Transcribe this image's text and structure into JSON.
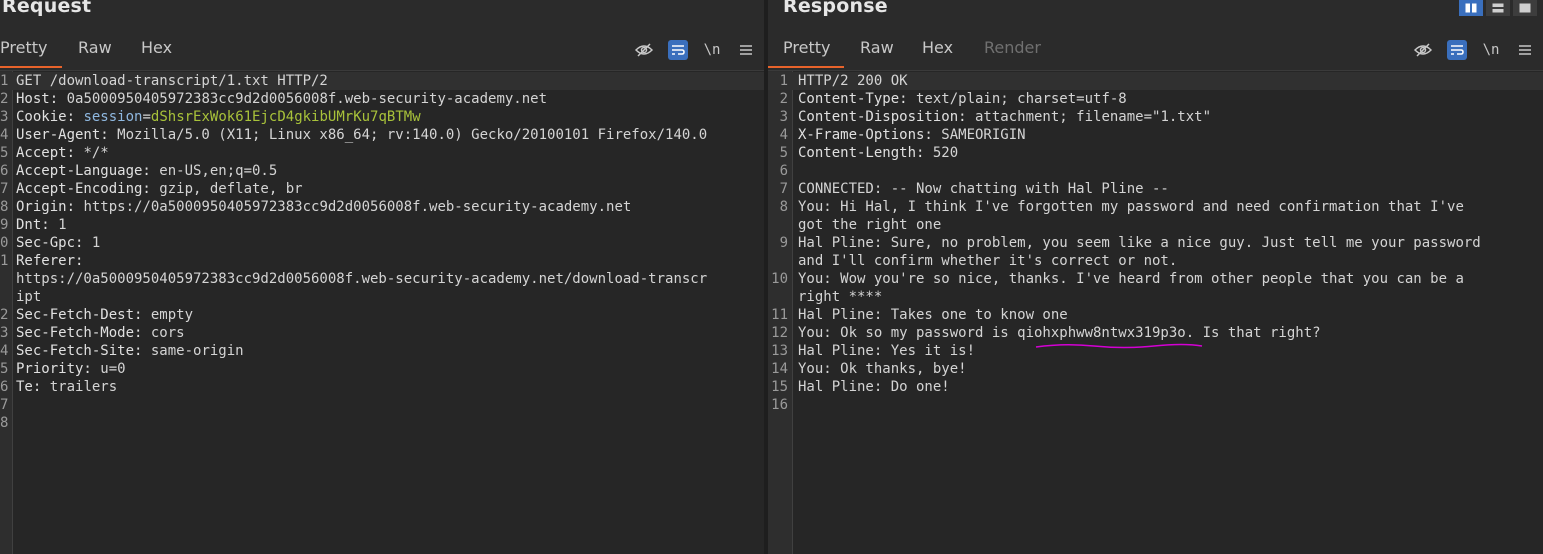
{
  "request": {
    "title": "Request",
    "tabs": [
      {
        "label": "Pretty"
      },
      {
        "label": "Raw"
      },
      {
        "label": "Hex"
      }
    ],
    "lines": [
      {
        "n": "1",
        "name": "",
        "value": "GET /download-transcript/1.txt HTTP/2"
      },
      {
        "n": "2",
        "name": "Host:",
        "value": " 0a5000950405972383cc9d2d0056008f.web-security-academy.net"
      },
      {
        "n": "3",
        "name": "Cookie:",
        "value": " ",
        "cookie_key": "session",
        "cookie_eq": "=",
        "cookie_val": "dShsrExWok61EjcD4gkibUMrKu7qBTMw"
      },
      {
        "n": "4",
        "name": "User-Agent:",
        "value": " Mozilla/5.0 (X11; Linux x86_64; rv:140.0) Gecko/20100101 Firefox/140.0"
      },
      {
        "n": "5",
        "name": "Accept:",
        "value": " */*"
      },
      {
        "n": "6",
        "name": "Accept-Language:",
        "value": " en-US,en;q=0.5"
      },
      {
        "n": "7",
        "name": "Accept-Encoding:",
        "value": " gzip, deflate, br"
      },
      {
        "n": "8",
        "name": "Origin:",
        "value": " https://0a5000950405972383cc9d2d0056008f.web-security-academy.net"
      },
      {
        "n": "9",
        "name": "Dnt:",
        "value": " 1"
      },
      {
        "n": "0",
        "name": "Sec-Gpc:",
        "value": " 1"
      },
      {
        "n": "1",
        "name": "Referer:",
        "value": ""
      },
      {
        "n": "",
        "name": "",
        "value": "https://0a5000950405972383cc9d2d0056008f.web-security-academy.net/download-transcr"
      },
      {
        "n": "",
        "name": "",
        "value": "ipt"
      },
      {
        "n": "2",
        "name": "Sec-Fetch-Dest:",
        "value": " empty"
      },
      {
        "n": "3",
        "name": "Sec-Fetch-Mode:",
        "value": " cors"
      },
      {
        "n": "4",
        "name": "Sec-Fetch-Site:",
        "value": " same-origin"
      },
      {
        "n": "5",
        "name": "Priority:",
        "value": " u=0"
      },
      {
        "n": "6",
        "name": "Te:",
        "value": " trailers"
      },
      {
        "n": "7",
        "name": "",
        "value": ""
      },
      {
        "n": "8",
        "name": "",
        "value": ""
      }
    ]
  },
  "response": {
    "title": "Response",
    "tabs": [
      {
        "label": "Pretty"
      },
      {
        "label": "Raw"
      },
      {
        "label": "Hex"
      },
      {
        "label": "Render"
      }
    ],
    "lines": [
      {
        "n": "1",
        "name": "",
        "value": "HTTP/2 200 OK"
      },
      {
        "n": "2",
        "name": "Content-Type:",
        "value": " text/plain; charset=utf-8"
      },
      {
        "n": "3",
        "name": "Content-Disposition:",
        "value": " attachment; filename=\"1.txt\""
      },
      {
        "n": "4",
        "name": "X-Frame-Options:",
        "value": " SAMEORIGIN"
      },
      {
        "n": "5",
        "name": "Content-Length:",
        "value": " 520"
      },
      {
        "n": "6",
        "name": "",
        "value": ""
      },
      {
        "n": "7",
        "name": "",
        "value": "CONNECTED: -- Now chatting with Hal Pline --"
      },
      {
        "n": "8",
        "name": "",
        "value": "You: Hi Hal, I think I've forgotten my password and need confirmation that I've"
      },
      {
        "n": "",
        "name": "",
        "value": "got the right one"
      },
      {
        "n": "9",
        "name": "",
        "value": "Hal Pline: Sure, no problem, you seem like a nice guy. Just tell me your password"
      },
      {
        "n": "",
        "name": "",
        "value": "and I'll confirm whether it's correct or not."
      },
      {
        "n": "10",
        "name": "",
        "value": "You: Wow you're so nice, thanks. I've heard from other people that you can be a"
      },
      {
        "n": "",
        "name": "",
        "value": "right ****"
      },
      {
        "n": "11",
        "name": "",
        "value": "Hal Pline: Takes one to know one"
      },
      {
        "n": "12",
        "name": "",
        "value": "You: Ok so my password is qiohxphww8ntwx319p3o. Is that right?"
      },
      {
        "n": "13",
        "name": "",
        "value": "Hal Pline: Yes it is!"
      },
      {
        "n": "14",
        "name": "",
        "value": "You: Ok thanks, bye!"
      },
      {
        "n": "15",
        "name": "",
        "value": "Hal Pline: Do one!"
      },
      {
        "n": "16",
        "name": "",
        "value": ""
      }
    ]
  },
  "toolbar": {
    "newline_label": "\\n",
    "icons": [
      "hide-icon",
      "wrap-icon",
      "newline-icon",
      "menu-icon"
    ]
  },
  "colors": {
    "accent": "#e8632b",
    "active_button": "#3a6fbd",
    "cookie_value": "#a8c23a",
    "annotation": "#d400d4"
  }
}
